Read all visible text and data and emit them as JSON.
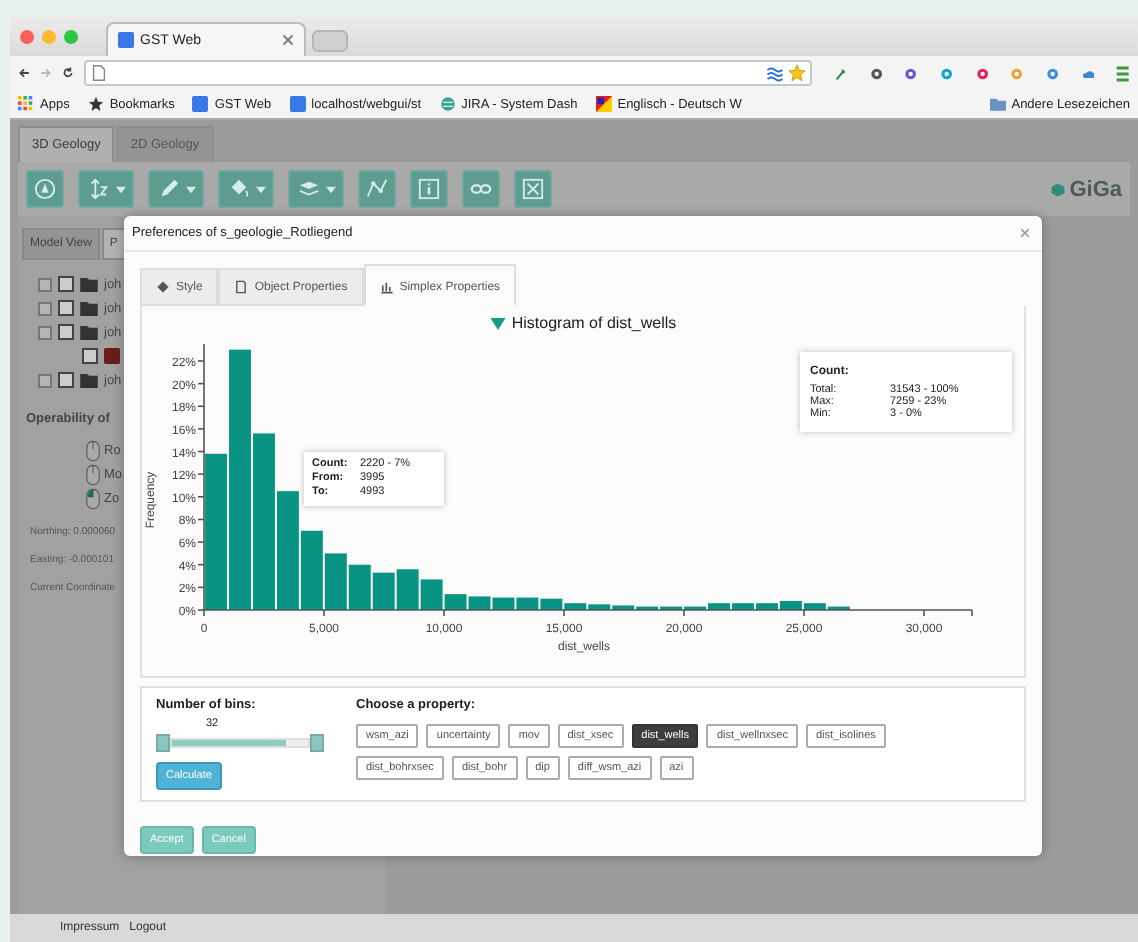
{
  "browser": {
    "tab_title": "GST Web",
    "bookmarks": [
      {
        "label": "Apps",
        "kind": "apps"
      },
      {
        "label": "Bookmarks",
        "kind": "star"
      },
      {
        "label": "GST Web",
        "kind": "google"
      },
      {
        "label": "localhost/webgui/st",
        "kind": "google"
      },
      {
        "label": "JIRA - System Dash",
        "kind": "jira"
      },
      {
        "label": "Englisch - Deutsch W",
        "kind": "dict"
      }
    ],
    "other_bookmarks": "Andere Lesezeichen"
  },
  "app": {
    "tabs": [
      {
        "label": "3D Geology",
        "selected": true
      },
      {
        "label": "2D Geology",
        "selected": false
      }
    ],
    "toolbar": [
      {
        "kind": "compass",
        "dropdown": false
      },
      {
        "kind": "axis",
        "dropdown": true
      },
      {
        "kind": "pencil",
        "dropdown": true
      },
      {
        "kind": "bucket",
        "dropdown": true
      },
      {
        "kind": "layers",
        "dropdown": true
      },
      {
        "kind": "graph",
        "dropdown": false
      },
      {
        "kind": "info",
        "dropdown": false
      },
      {
        "kind": "link",
        "dropdown": false
      },
      {
        "kind": "fullscreen",
        "dropdown": false
      }
    ],
    "logo": "GiGa",
    "side_tabs": [
      {
        "label": "Model View",
        "selected": false
      },
      {
        "label": "P",
        "selected": true
      }
    ],
    "tree": [
      {
        "label": "joh",
        "kind": "folder",
        "checked": false
      },
      {
        "label": "joh",
        "kind": "folder",
        "checked": false
      },
      {
        "label": "joh",
        "kind": "folder",
        "checked": false
      },
      {
        "kind": "swatch",
        "checked": false
      },
      {
        "label": "joh",
        "kind": "folder",
        "checked": false
      }
    ],
    "operability_title": "Operability of",
    "modes": [
      {
        "label": "Ro",
        "selected": false
      },
      {
        "label": "Mo",
        "selected": false
      },
      {
        "label": "Zo",
        "selected": true
      }
    ],
    "coords": [
      "Northing: 0.000060",
      "Easting: -0.000101",
      "Current Coordinate"
    ],
    "footer": [
      "Impressum",
      "Logout"
    ]
  },
  "dialog": {
    "title": "Preferences of s_geologie_Rotliegend",
    "tabs": [
      {
        "label": "Style",
        "kind": "style",
        "selected": false
      },
      {
        "label": "Object Properties",
        "kind": "object",
        "selected": false
      },
      {
        "label": "Simplex Properties",
        "kind": "simplex",
        "selected": true
      }
    ],
    "histogram_title": "Histogram of dist_wells",
    "chart_data": {
      "type": "bar",
      "xlabel": "dist_wells",
      "ylabel": "Frequency",
      "x": [
        502,
        1500,
        2498,
        3496,
        4494,
        5492,
        6490,
        7488,
        8486,
        9484,
        10482,
        11480,
        12478,
        13476,
        14474,
        15472,
        16470,
        17468,
        18466,
        19464,
        20462,
        21460,
        22458,
        23456,
        24454,
        25452,
        26450
      ],
      "values": [
        13.8,
        23.0,
        15.6,
        10.5,
        7.0,
        5.0,
        4.0,
        3.3,
        3.6,
        2.7,
        1.4,
        1.2,
        1.1,
        1.1,
        1.0,
        0.6,
        0.5,
        0.4,
        0.3,
        0.3,
        0.3,
        0.6,
        0.6,
        0.6,
        0.8,
        0.6,
        0.3
      ],
      "xlim": [
        0,
        32000
      ],
      "ylim": [
        0,
        23.5
      ],
      "xticks": [
        {
          "value": 0,
          "label": "0"
        },
        {
          "value": 5000,
          "label": "5,000"
        },
        {
          "value": 10000,
          "label": "10,000"
        },
        {
          "value": 15000,
          "label": "15,000"
        },
        {
          "value": 20000,
          "label": "20,000"
        },
        {
          "value": 25000,
          "label": "25,000"
        },
        {
          "value": 30000,
          "label": "30,000"
        }
      ],
      "yticks": [
        {
          "value": 0,
          "label": "0%"
        },
        {
          "value": 2,
          "label": "2%"
        },
        {
          "value": 4,
          "label": "4%"
        },
        {
          "value": 6,
          "label": "6%"
        },
        {
          "value": 8,
          "label": "8%"
        },
        {
          "value": 10,
          "label": "10%"
        },
        {
          "value": 12,
          "label": "12%"
        },
        {
          "value": 14,
          "label": "14%"
        },
        {
          "value": 16,
          "label": "16%"
        },
        {
          "value": 18,
          "label": "18%"
        },
        {
          "value": 20,
          "label": "20%"
        },
        {
          "value": 22,
          "label": "22%"
        }
      ]
    },
    "summary": {
      "title": "Count:",
      "rows": [
        {
          "label": "Total:",
          "value": "31543 - 100%"
        },
        {
          "label": "Max:",
          "value": "7259 - 23%"
        },
        {
          "label": "Min:",
          "value": "3 - 0%"
        }
      ]
    },
    "tooltip": [
      {
        "label": "Count:",
        "value": "2220 - 7%"
      },
      {
        "label": "From:",
        "value": "3995"
      },
      {
        "label": "To:",
        "value": "4993"
      }
    ],
    "bins_label": "Number of bins:",
    "bins_value": "32",
    "bins_slider": {
      "level": 0.84
    },
    "calculate": "Calculate",
    "property_label": "Choose a property:",
    "properties": [
      {
        "label": "wsm_azi",
        "selected": false
      },
      {
        "label": "uncertainty",
        "selected": false
      },
      {
        "label": "mov",
        "selected": false
      },
      {
        "label": "dist_xsec",
        "selected": false
      },
      {
        "label": "dist_wells",
        "selected": true
      },
      {
        "label": "dist_wellnxsec",
        "selected": false
      },
      {
        "label": "dist_isolines",
        "selected": false
      },
      {
        "label": "dist_bohrxsec",
        "selected": false
      },
      {
        "label": "dist_bohr",
        "selected": false
      },
      {
        "label": "dip",
        "selected": false
      },
      {
        "label": "diff_wsm_azi",
        "selected": false
      },
      {
        "label": "azi",
        "selected": false
      }
    ],
    "buttons": [
      "Accept",
      "Cancel"
    ]
  }
}
